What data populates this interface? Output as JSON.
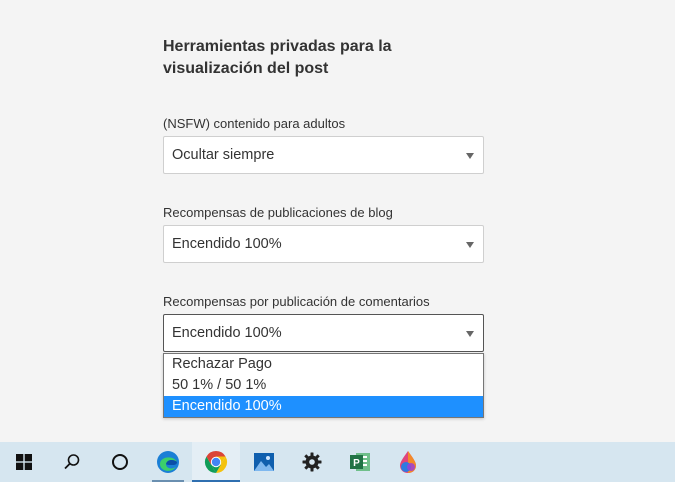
{
  "section": {
    "heading": "Herramientas privadas para la visualización del post"
  },
  "fields": [
    {
      "label": "(NSFW) contenido para adultos",
      "value": "Ocultar siempre"
    },
    {
      "label": "Recompensas de publicaciones de blog",
      "value": "Encendido 100%"
    },
    {
      "label": "Recompensas por publicación de comentarios",
      "value": "Encendido 100%"
    }
  ],
  "dropdown": {
    "options": [
      "Rechazar Pago",
      "50 1% / 50 1%",
      "Encendido 100%"
    ],
    "selected_index": 2
  },
  "colors": {
    "background": "#f4f4f4",
    "highlight": "#1e90ff",
    "taskbar": "#d6e6f0"
  },
  "taskbar": {
    "icons": [
      "windows-start-icon",
      "search-icon",
      "cortana-icon",
      "edge-icon",
      "chrome-icon",
      "photos-icon",
      "settings-icon",
      "project-icon",
      "paint-icon"
    ]
  }
}
